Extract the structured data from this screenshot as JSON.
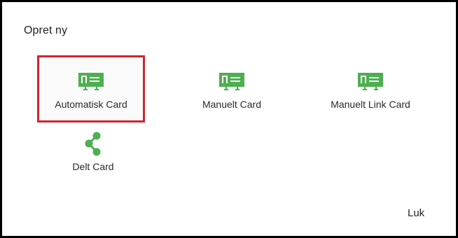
{
  "dialog": {
    "title": "Opret ny",
    "close_label": "Luk"
  },
  "options": [
    {
      "label": "Automatisk Card",
      "icon": "card-icon",
      "selected": true
    },
    {
      "label": "Manuelt Card",
      "icon": "card-icon",
      "selected": false
    },
    {
      "label": "Manuelt Link Card",
      "icon": "card-icon",
      "selected": false
    },
    {
      "label": "Delt Card",
      "icon": "share-icon",
      "selected": false
    }
  ],
  "colors": {
    "icon_green": "#4caf50",
    "selection_red": "#d0262f"
  }
}
